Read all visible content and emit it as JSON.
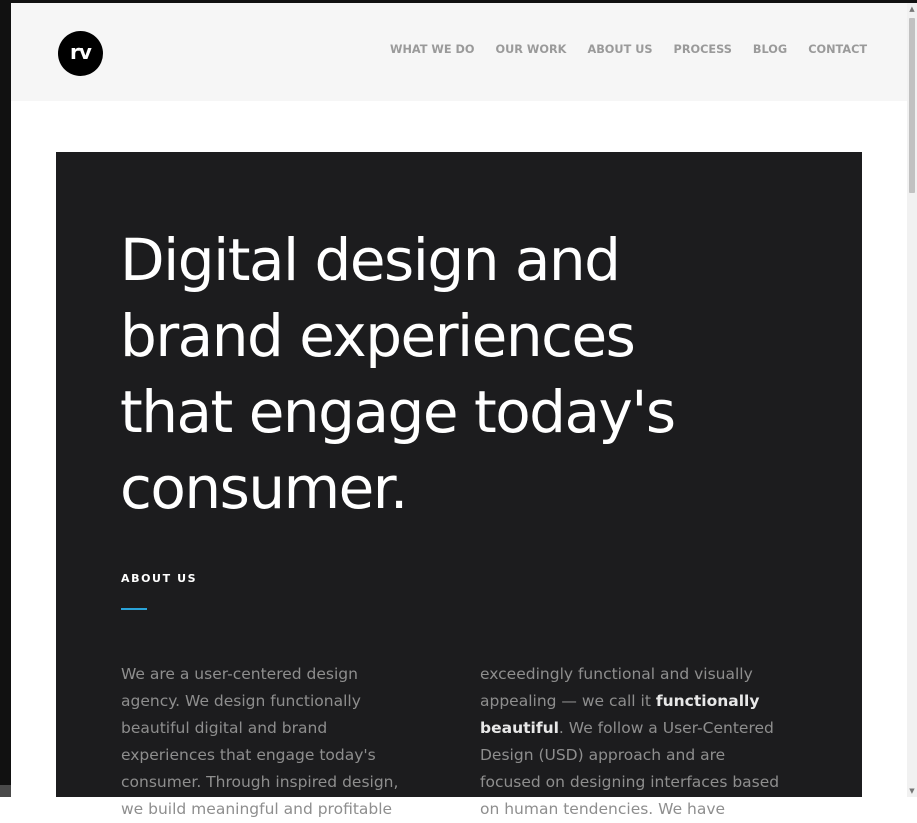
{
  "header": {
    "logo_text": "rv",
    "nav": [
      "WHAT WE DO",
      "OUR WORK",
      "ABOUT US",
      "PROCESS",
      "BLOG",
      "CONTACT"
    ]
  },
  "hero": {
    "headline": "Digital design and brand experiences that engage today's consumer.",
    "section_label": "ABOUT US",
    "col1_text": "We are a user-centered design agency. We design functionally beautiful digital and brand experiences that engage today's consumer. Through inspired design, we build meaningful and profitable",
    "col2_before": "exceedingly functional and visually appealing — we call it ",
    "col2_bold": "functionally beautiful",
    "col2_after": ". We follow a User-Centered Design (USD) approach and are focused on designing interfaces based on human tendencies. We have"
  },
  "colors": {
    "hero_bg": "#1c1c1e",
    "accent": "#2aa3d8",
    "nav_text": "#9a9a9a",
    "body_text": "#8e8e8e"
  },
  "icons": {
    "scroll_up": "scroll-up-arrow-icon",
    "scroll_down": "scroll-down-arrow-icon"
  }
}
